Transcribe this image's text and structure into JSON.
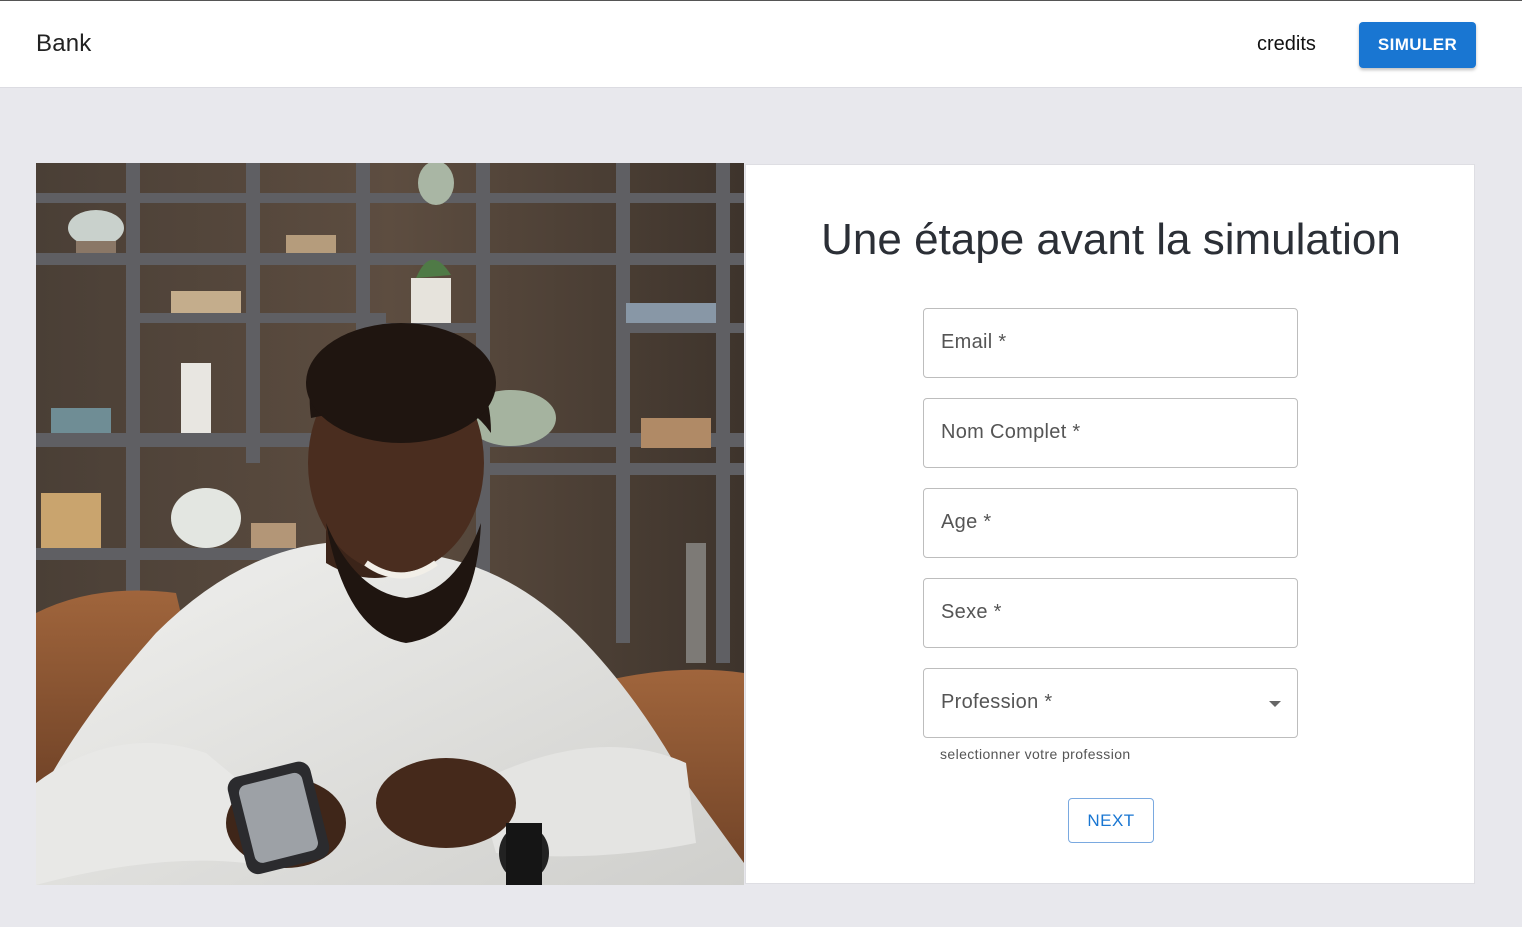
{
  "header": {
    "brand": "Bank",
    "nav_link": "credits",
    "cta_label": "SIMULER",
    "accent_color": "#1976d2"
  },
  "hero_image": {
    "description_icon": "photo-man-smartphone"
  },
  "form": {
    "title": "Une étape avant la simulation",
    "fields": [
      {
        "label": "Email *"
      },
      {
        "label": "Nom Complet *"
      },
      {
        "label": "Age *"
      },
      {
        "label": "Sexe *"
      },
      {
        "label": "Profession *",
        "type": "select",
        "helper": "selectionner votre profession"
      }
    ],
    "next_label": "NEXT"
  }
}
